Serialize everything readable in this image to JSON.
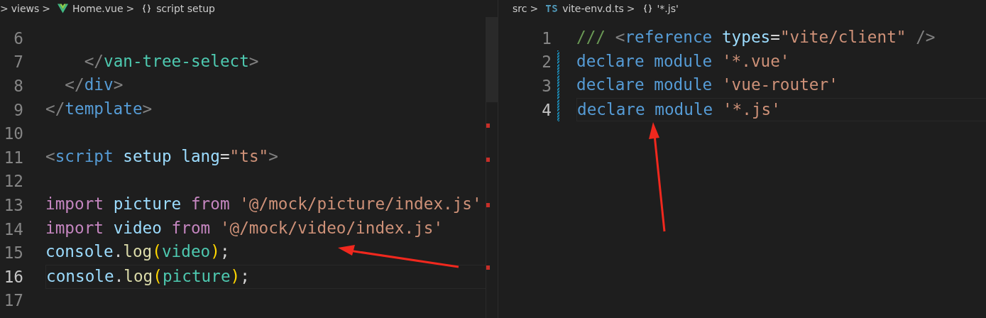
{
  "editors": [
    {
      "breadcrumbs": [
        {
          "kind": "chevron",
          "text": ">"
        },
        {
          "kind": "folder",
          "text": "views"
        },
        {
          "kind": "chevron",
          "text": ">"
        },
        {
          "kind": "vue",
          "text": "Home.vue"
        },
        {
          "kind": "chevron",
          "text": ">"
        },
        {
          "kind": "symbol",
          "text": "script setup"
        }
      ],
      "lines": [
        {
          "number": "6",
          "current": false
        },
        {
          "number": "7",
          "current": false,
          "tokens": [
            {
              "kind": "punct",
              "text": "    </"
            },
            {
              "kind": "component",
              "text": "van-tree-select"
            },
            {
              "kind": "punct",
              "text": ">"
            }
          ]
        },
        {
          "number": "8",
          "current": false,
          "tokens": [
            {
              "kind": "punct",
              "text": "  </"
            },
            {
              "kind": "tag",
              "text": "div"
            },
            {
              "kind": "punct",
              "text": ">"
            }
          ]
        },
        {
          "number": "9",
          "current": false,
          "tokens": [
            {
              "kind": "punct",
              "text": "</"
            },
            {
              "kind": "tag",
              "text": "template"
            },
            {
              "kind": "punct",
              "text": ">"
            }
          ]
        },
        {
          "number": "10",
          "current": false
        },
        {
          "number": "11",
          "current": false,
          "tokens": [
            {
              "kind": "punct",
              "text": "<"
            },
            {
              "kind": "tag",
              "text": "script"
            },
            {
              "kind": "attr",
              "text": " setup"
            },
            {
              "kind": "attr",
              "text": " lang"
            },
            {
              "kind": "plain",
              "text": "="
            },
            {
              "kind": "string",
              "text": "\"ts\""
            },
            {
              "kind": "punct",
              "text": ">"
            }
          ]
        },
        {
          "number": "12",
          "current": false
        },
        {
          "number": "13",
          "current": false,
          "tokens": [
            {
              "kind": "keyword",
              "text": "import"
            },
            {
              "kind": "variable",
              "text": " picture"
            },
            {
              "kind": "keyword",
              "text": " from"
            },
            {
              "kind": "string",
              "text": " '@/mock/picture/index.js'"
            }
          ]
        },
        {
          "number": "14",
          "current": false,
          "tokens": [
            {
              "kind": "keyword",
              "text": "import"
            },
            {
              "kind": "variable",
              "text": " video"
            },
            {
              "kind": "keyword",
              "text": " from"
            },
            {
              "kind": "string",
              "text": " '@/mock/video/index.js'"
            }
          ]
        },
        {
          "number": "15",
          "current": false,
          "tokens": [
            {
              "kind": "variable",
              "text": "console"
            },
            {
              "kind": "plain",
              "text": "."
            },
            {
              "kind": "function",
              "text": "log"
            },
            {
              "kind": "paren",
              "text": "("
            },
            {
              "kind": "class",
              "text": "video"
            },
            {
              "kind": "paren",
              "text": ")"
            },
            {
              "kind": "plain",
              "text": ";"
            }
          ]
        },
        {
          "number": "16",
          "current": true,
          "tokens": [
            {
              "kind": "variable",
              "text": "console"
            },
            {
              "kind": "plain",
              "text": "."
            },
            {
              "kind": "function",
              "text": "log"
            },
            {
              "kind": "paren",
              "text": "("
            },
            {
              "kind": "class",
              "text": "picture"
            },
            {
              "kind": "paren",
              "text": ")"
            },
            {
              "kind": "plain",
              "text": ";"
            }
          ]
        },
        {
          "number": "17",
          "current": false
        }
      ]
    },
    {
      "breadcrumbs": [
        {
          "kind": "folder",
          "text": "src"
        },
        {
          "kind": "chevron",
          "text": ">"
        },
        {
          "kind": "ts",
          "text": "vite-env.d.ts"
        },
        {
          "kind": "chevron",
          "text": ">"
        },
        {
          "kind": "symbol",
          "text": "'*.js'"
        }
      ],
      "lines": [
        {
          "number": "1",
          "current": false,
          "modified": false,
          "tokens": [
            {
              "kind": "comment",
              "text": "///"
            },
            {
              "kind": "punct",
              "text": " <"
            },
            {
              "kind": "tag",
              "text": "reference"
            },
            {
              "kind": "attr",
              "text": " types"
            },
            {
              "kind": "plain",
              "text": "="
            },
            {
              "kind": "string",
              "text": "\"vite/client\""
            },
            {
              "kind": "punct",
              "text": " />"
            }
          ]
        },
        {
          "number": "2",
          "current": false,
          "modified": true,
          "tokens": [
            {
              "kind": "tag",
              "text": "declare"
            },
            {
              "kind": "tag",
              "text": " module"
            },
            {
              "kind": "string",
              "text": " '*.vue'"
            }
          ]
        },
        {
          "number": "3",
          "current": false,
          "modified": true,
          "tokens": [
            {
              "kind": "tag",
              "text": "declare"
            },
            {
              "kind": "tag",
              "text": " module"
            },
            {
              "kind": "string",
              "text": " 'vue-router'"
            }
          ]
        },
        {
          "number": "4",
          "current": true,
          "modified": true,
          "tokens": [
            {
              "kind": "tag",
              "text": "declare"
            },
            {
              "kind": "tag",
              "text": " module"
            },
            {
              "kind": "string",
              "text": " '*.js'"
            }
          ]
        }
      ]
    }
  ]
}
